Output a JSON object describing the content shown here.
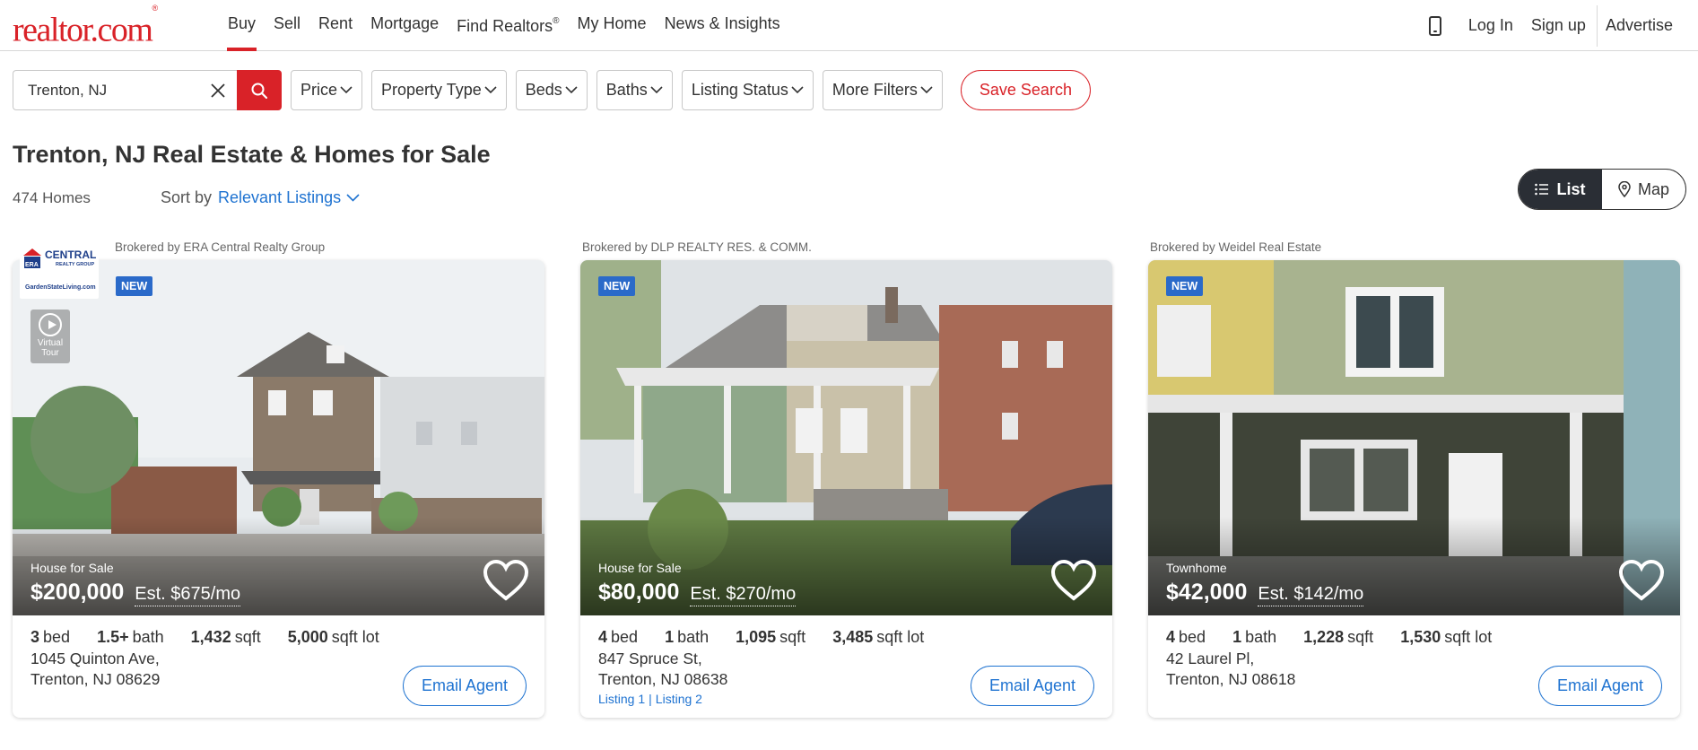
{
  "header": {
    "logo": "realtor.com",
    "logo_mark": "®",
    "nav": [
      {
        "label": "Buy",
        "active": true
      },
      {
        "label": "Sell"
      },
      {
        "label": "Rent"
      },
      {
        "label": "Mortgage"
      },
      {
        "label": "Find Realtors",
        "sup": "®"
      },
      {
        "label": "My Home"
      },
      {
        "label": "News & Insights"
      }
    ],
    "phone_icon": "mobile-phone-icon",
    "login": "Log In",
    "signup": "Sign up",
    "advertise": "Advertise"
  },
  "search": {
    "value": "Trenton, NJ",
    "clear_icon": "close-icon",
    "search_icon": "search-icon",
    "filters": [
      "Price",
      "Property Type",
      "Beds",
      "Baths",
      "Listing Status",
      "More Filters"
    ],
    "save_search": "Save Search"
  },
  "results": {
    "title": "Trenton, NJ Real Estate & Homes for Sale",
    "count": "474 Homes",
    "sort_label": "Sort by",
    "sort_value": "Relevant Listings",
    "view_list": "List",
    "view_map": "Map"
  },
  "colors": {
    "brand_red": "#d92228",
    "link_blue": "#1f73d1",
    "badge_blue": "#2a6ac9",
    "toggle_dark": "#2a2e35"
  },
  "listings": [
    {
      "broker": "Brokered by ERA Central Realty Group",
      "badge": "NEW",
      "virtual_tour": "Virtual Tour",
      "logo_name": "ERA",
      "logo_text": "CENTRAL",
      "logo_sub": "REALTY GROUP",
      "logo_url": "GardenStateLiving.com",
      "type": "House for Sale",
      "price": "$200,000",
      "est": "Est. $675/mo",
      "beds": "3",
      "beds_label": "bed",
      "baths": "1.5+",
      "baths_label": "bath",
      "sqft": "1,432",
      "sqft_label": "sqft",
      "lot": "5,000",
      "lot_label": "sqft lot",
      "address1": "1045 Quinton Ave,",
      "address2": "Trenton, NJ 08629",
      "email": "Email Agent"
    },
    {
      "broker": "Brokered by DLP REALTY RES. & COMM.",
      "badge": "NEW",
      "type": "House for Sale",
      "price": "$80,000",
      "est": "Est. $270/mo",
      "beds": "4",
      "beds_label": "bed",
      "baths": "1",
      "baths_label": "bath",
      "sqft": "1,095",
      "sqft_label": "sqft",
      "lot": "3,485",
      "lot_label": "sqft lot",
      "address1": "847 Spruce St,",
      "address2": "Trenton, NJ 08638",
      "link1": "Listing 1",
      "link_sep": "|",
      "link2": "Listing 2",
      "email": "Email Agent"
    },
    {
      "broker": "Brokered by Weidel Real Estate",
      "badge": "NEW",
      "type": "Townhome",
      "price": "$42,000",
      "est": "Est. $142/mo",
      "beds": "4",
      "beds_label": "bed",
      "baths": "1",
      "baths_label": "bath",
      "sqft": "1,228",
      "sqft_label": "sqft",
      "lot": "1,530",
      "lot_label": "sqft lot",
      "address1": "42 Laurel Pl,",
      "address2": "Trenton, NJ 08618",
      "email": "Email Agent"
    }
  ]
}
